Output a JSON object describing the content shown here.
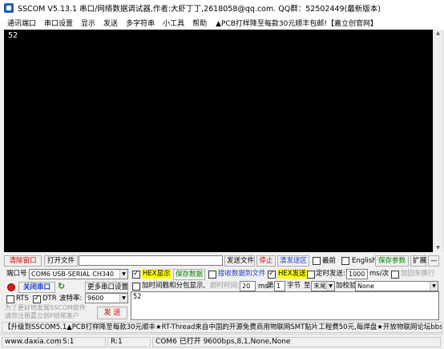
{
  "title": "SSCOM V5.13.1 串口/网络数据调试器,作者:大虾丁丁,2618058@qq.com. QQ群：52502449(最新版本)",
  "menu": {
    "items": [
      "通讯端口",
      "串口设置",
      "显示",
      "发送",
      "多字符串",
      "小工具",
      "帮助"
    ],
    "promo": "▲PCB打样降至每款30元顺丰包邮!【嘉立创官网】"
  },
  "receive": {
    "text": "52"
  },
  "toolbar": {
    "clear_window": "清除窗口",
    "open_file": "打开文件",
    "file_path": "",
    "send_file": "发送文件",
    "stop": "停止",
    "clear_send": "清发送区",
    "topmost": "最前",
    "english": "English",
    "save_params": "保存参数",
    "expand": "扩展",
    "collapse": "—"
  },
  "port": {
    "label": "端口号",
    "value": "COM6 USB-SERIAL CH340",
    "hex_display": "HEX显示",
    "save_data": "保存数据",
    "recv_to_file": "接收数据到文件",
    "hex_send": "HEX发送",
    "timed_send": "定时发送:",
    "interval": "1000",
    "interval_unit": "ms/次",
    "add_crlf": "加回车换行"
  },
  "open_port": "关闭串口",
  "more_settings": "更多串口设置",
  "timestamp": {
    "label": "加时间戳和分包显示,",
    "timeout_label": "超时时间:",
    "timeout": "20",
    "unit": "ms",
    "nth": "第",
    "byte_index": "1",
    "byte": "字节",
    "to": "至",
    "end": "末尾",
    "checksum": "加校验",
    "checksum_value": "None"
  },
  "lines": {
    "rts": "RTS",
    "dtr": "DTR"
  },
  "baud": {
    "label": "波特率:",
    "value": "9600"
  },
  "send": {
    "text": "52",
    "button": "发 送"
  },
  "hint": "为了更好地发展SSCOM软件\n请您注册嘉立创P结尾客户",
  "ticker": "【升级到SSCOM5.1▲PCB打样降至每款30元顺丰★RT-Thread来自中国的开源免费商用物联网SMT贴片工程费50元,每焊盘★开放物联网论坛bbs.a",
  "status": {
    "site": "www.daxia.com",
    "s": "S:1",
    "r": "R:1",
    "port_state": "COM6 已打开  9600bps,8,1,None,None"
  }
}
